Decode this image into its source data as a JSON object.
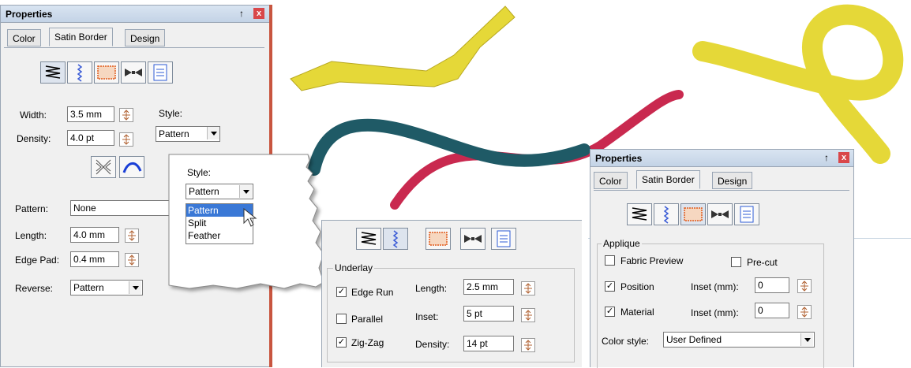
{
  "left_panel": {
    "title": "Properties",
    "pin": "↑",
    "close": "x",
    "tabs": [
      "Color",
      "Satin Border",
      "Design"
    ],
    "width_label": "Width:",
    "width_value": "3.5 mm",
    "density_label": "Density:",
    "density_value": "4.0 pt",
    "style_label": "Style:",
    "style_value": "Pattern",
    "pattern_label": "Pattern:",
    "pattern_value": "None",
    "length_label": "Length:",
    "length_value": "4.0 mm",
    "edgepad_label": "Edge Pad:",
    "edgepad_value": "0.4 mm",
    "reverse_label": "Reverse:",
    "reverse_value": "Pattern"
  },
  "style_popup": {
    "label": "Style:",
    "value": "Pattern",
    "options": [
      "Pattern",
      "Split",
      "Feather"
    ],
    "selected": "Pattern"
  },
  "underlay_panel": {
    "group_label": "Underlay",
    "edge_run": "Edge Run",
    "parallel": "Parallel",
    "zigzag": "Zig-Zag",
    "length_label": "Length:",
    "length_value": "2.5 mm",
    "inset_label": "Inset:",
    "inset_value": "5 pt",
    "density_label": "Density:",
    "density_value": "14 pt",
    "checks": {
      "edge_run": true,
      "parallel": false,
      "zigzag": true
    },
    "check_mark": "✓"
  },
  "right_panel": {
    "title": "Properties",
    "pin": "↑",
    "close": "x",
    "tabs": [
      "Color",
      "Satin Border",
      "Design"
    ],
    "group_label": "Applique",
    "fabric_preview": "Fabric Preview",
    "precut": "Pre-cut",
    "position": "Position",
    "material": "Material",
    "inset_label": "Inset (mm):",
    "inset_position": "0",
    "inset_material": "0",
    "color_style_label": "Color style:",
    "color_style_value": "User Defined",
    "checks": {
      "fabric_preview": false,
      "precut": false,
      "position": true,
      "material": true
    },
    "check_mark": "✓"
  },
  "colors": {
    "yellow": "#e5d838",
    "teal": "#1f5a66",
    "crimson": "#c9294f",
    "selection": "#3a78d6"
  }
}
